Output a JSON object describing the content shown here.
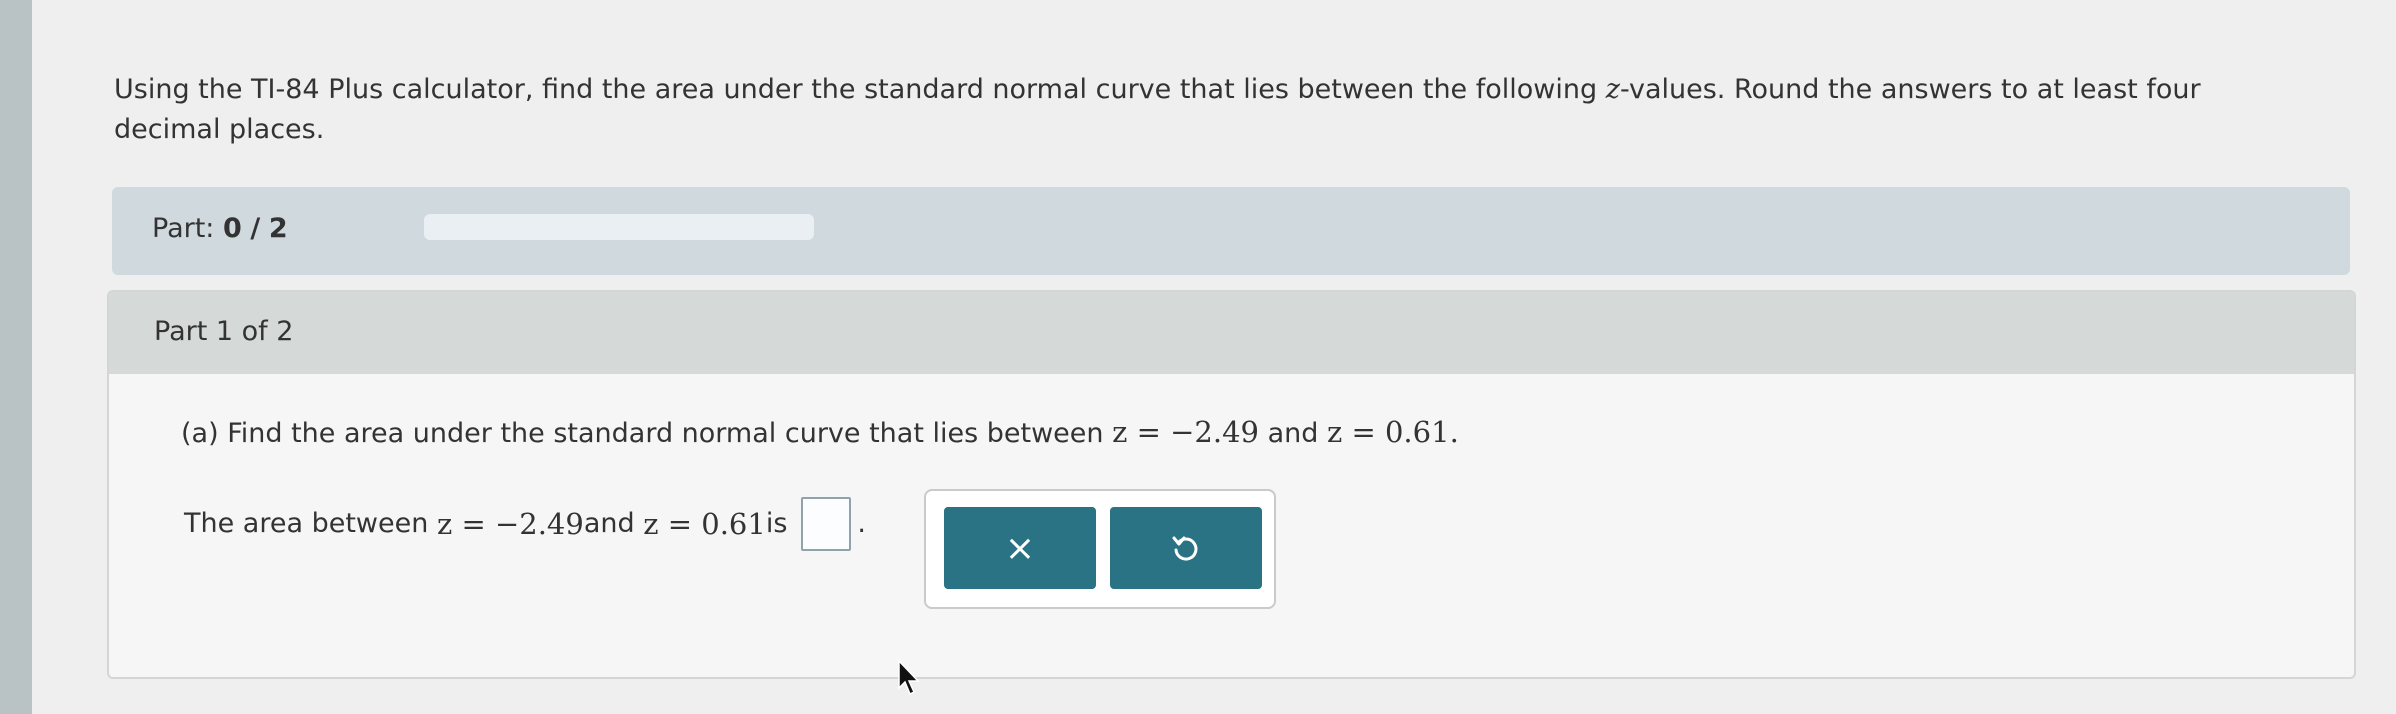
{
  "question": {
    "text_before": "Using the TI-84 Plus calculator, find the area under the standard normal curve that lies between the following ",
    "variable": "z",
    "text_after": "-values. Round the answers to at least four decimal places."
  },
  "progress": {
    "label": "Part:",
    "current": "0",
    "separator": "/",
    "total": "2",
    "fraction": 0
  },
  "part": {
    "header": "Part 1 of 2",
    "question_prefix": "(a) Find the area under the standard normal curve that lies between ",
    "z1": "z = −2.49",
    "and": " and ",
    "z2": "z = 0.61",
    "question_suffix": ".",
    "answer_prefix": "The area between ",
    "answer_z1": "z = −2.49",
    "answer_and": " and ",
    "answer_z2": "z = 0.61",
    "answer_is": " is",
    "answer_value": "",
    "answer_suffix": "."
  },
  "tools": {
    "clear_glyph": "×",
    "undo_glyph": "↺"
  },
  "colors": {
    "button": "#2a7384",
    "part_bar": "#cfd9de",
    "header": "#d5d9d8"
  }
}
